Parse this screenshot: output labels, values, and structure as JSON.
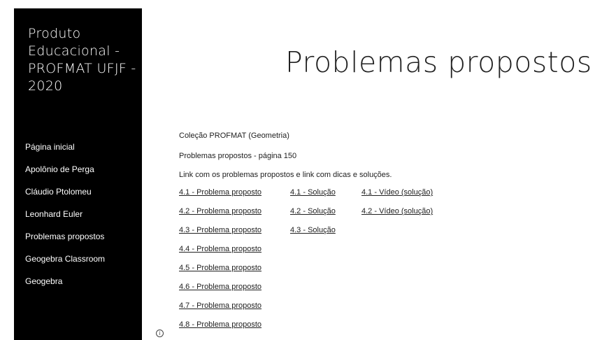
{
  "site": {
    "title": "Produto Educacional - PROFMAT UFJF - 2020"
  },
  "nav": {
    "items": [
      {
        "label": "Página inicial"
      },
      {
        "label": "Apolônio de Perga"
      },
      {
        "label": "Cláudio Ptolomeu"
      },
      {
        "label": "Leonhard Euler"
      },
      {
        "label": "Problemas propostos"
      },
      {
        "label": "Geogebra Classroom"
      },
      {
        "label": "Geogebra"
      }
    ]
  },
  "page": {
    "title": "Problemas propostos",
    "collection": "Coleção PROFMAT (Geometria)",
    "subtitle": "Problemas propostos - página 150",
    "description": "Link com os problemas propostos e link com dicas e soluções."
  },
  "links": {
    "rows": [
      {
        "problem": "4.1 - Problema proposto",
        "solution": "4.1 - Solução",
        "video": "4.1 - Vídeo (solução)"
      },
      {
        "problem": "4.2 - Problema proposto",
        "solution": "4.2 - Solução",
        "video": "4.2 - Vídeo (solução)"
      },
      {
        "problem": "4.3 - Problema proposto",
        "solution": "4.3 - Solução"
      },
      {
        "problem": "4.4 - Problema proposto"
      },
      {
        "problem": "4.5 - Problema proposto"
      },
      {
        "problem": "4.6 - Problema proposto"
      },
      {
        "problem": "4.7 - Problema proposto"
      },
      {
        "problem": "4.8 - Problema proposto"
      }
    ]
  },
  "icons": {
    "info": "info-icon"
  }
}
